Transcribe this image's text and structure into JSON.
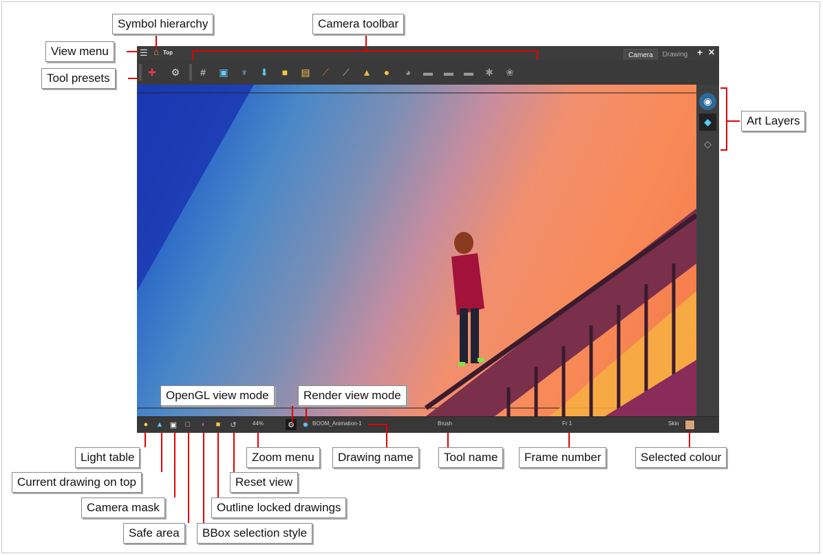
{
  "app": {
    "top_bar": {
      "breadcrumb": "Top",
      "tabs": [
        "Camera",
        "Drawing"
      ]
    },
    "toolbar_icons": [
      "tool-presets-icon",
      "settings-gear-icon",
      "grid-icon",
      "camera-mask-icon",
      "onion-skin-icon",
      "light-table-icon",
      "lock-icon",
      "unlock-icon",
      "ruler-icon",
      "guides-icon",
      "lighting-icon",
      "mirror-icon",
      "stand-1-icon",
      "stand-2-icon",
      "stand-3-icon",
      "stand-4-icon",
      "stand-5-icon",
      "stand-6-icon"
    ],
    "status_bar": {
      "zoom": "44%",
      "drawing_name": "BOOM_Animation-1",
      "tool_name": "Brush",
      "frame": "Fr 1",
      "colour_name": "Skin",
      "colour_hex": "#d7a37a"
    }
  },
  "callouts": {
    "symbol_hierarchy": "Symbol hierarchy",
    "camera_toolbar": "Camera toolbar",
    "view_menu": "View menu",
    "tool_presets": "Tool presets",
    "art_layers": "Art Layers",
    "opengl_view_mode": "OpenGL view mode",
    "render_view_mode": "Render view mode",
    "light_table": "Light table",
    "zoom_menu": "Zoom menu",
    "drawing_name": "Drawing name",
    "tool_name": "Tool name",
    "frame_number": "Frame number",
    "selected_colour": "Selected colour",
    "current_drawing_on_top": "Current drawing on top",
    "reset_view": "Reset view",
    "camera_mask": "Camera mask",
    "outline_locked_drawings": "Outline locked drawings",
    "safe_area": "Safe area",
    "bbox_selection_style": "BBox selection style"
  }
}
